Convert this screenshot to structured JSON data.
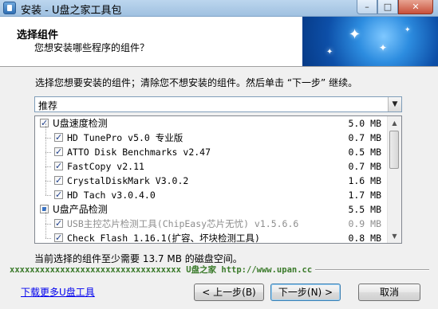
{
  "window": {
    "title": "安装 - U盘之家工具包",
    "controls": {
      "minimize": "–",
      "maximize": "□",
      "close": "✕"
    }
  },
  "header": {
    "title": "选择组件",
    "subtitle": "您想安装哪些程序的组件？"
  },
  "description": "选择您想要安装的组件；清除您不想安装的组件。然后单击 “下一步” 继续。",
  "preset": {
    "selected": "推荐"
  },
  "components": [
    {
      "label": "U盘速度检测",
      "size": "5.0 MB",
      "level": 0,
      "state": "checked",
      "cjk": true,
      "grey": false
    },
    {
      "label": "HD TunePro v5.0 专业版",
      "size": "0.7 MB",
      "level": 1,
      "state": "checked",
      "cjk": false,
      "grey": false
    },
    {
      "label": "ATTO Disk Benchmarks v2.47",
      "size": "0.5 MB",
      "level": 1,
      "state": "checked",
      "cjk": false,
      "grey": false
    },
    {
      "label": "FastCopy v2.11",
      "size": "0.7 MB",
      "level": 1,
      "state": "checked",
      "cjk": false,
      "grey": false
    },
    {
      "label": "CrystalDiskMark V3.0.2",
      "size": "1.6 MB",
      "level": 1,
      "state": "checked",
      "cjk": false,
      "grey": false
    },
    {
      "label": "HD Tach v3.0.4.0",
      "size": "1.7 MB",
      "level": 1,
      "state": "checked",
      "cjk": false,
      "grey": false
    },
    {
      "label": "U盘产品检测",
      "size": "5.5 MB",
      "level": 0,
      "state": "partial",
      "cjk": true,
      "grey": false
    },
    {
      "label": "USB主控芯片检测工具(ChipEasy芯片无忧) v1.5.6.6",
      "size": "0.9 MB",
      "level": 1,
      "state": "checked",
      "cjk": false,
      "grey": true
    },
    {
      "label": "Check Flash 1.16.1(扩容、坏块检测工具)",
      "size": "0.8 MB",
      "level": 1,
      "state": "checked",
      "cjk": false,
      "grey": false
    }
  ],
  "space_required": "当前选择的组件至少需要 13.7 MB 的磁盘空间。",
  "brand_line": "xxxxxxxxxxxxxxxxxxxxxxxxxxxxxxxxxx U盘之家 http://www.upan.cc",
  "more_link": "下载更多U盘工具",
  "buttons": {
    "back": "< 上一步(B)",
    "next": "下一步(N) >",
    "cancel": "取消"
  }
}
